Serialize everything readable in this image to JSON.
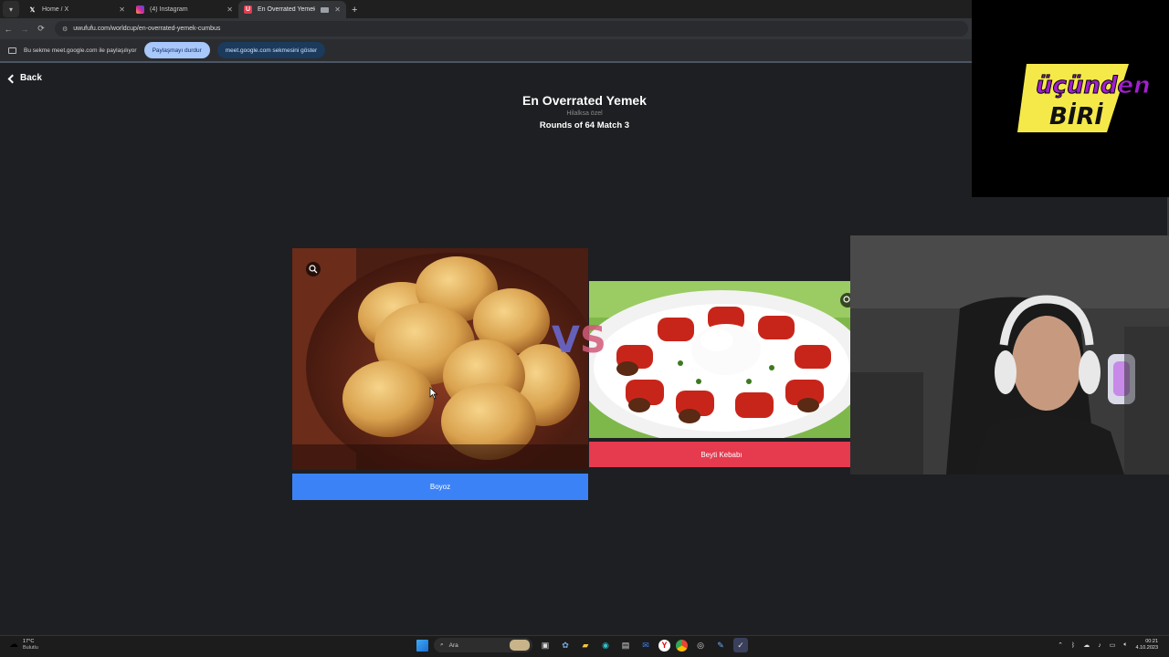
{
  "browser": {
    "tabs": [
      {
        "title": "Home / X",
        "icon": "x-logo-icon",
        "active": false
      },
      {
        "title": "(4) Instagram",
        "icon": "instagram-icon",
        "active": false
      },
      {
        "title": "En Overrated Yemek | Uwu",
        "icon": "uwufufu-icon",
        "active": true
      }
    ],
    "url": "uwufufu.com/worldcup/en-overrated-yemek-cumbus",
    "share_bar": {
      "message": "Bu sekme meet.google.com ile paylaşılıyor",
      "stop_button": "Paylaşmayı durdur",
      "show_button": "meet.google.com sekmesini göster"
    }
  },
  "page": {
    "back_label": "Back",
    "title": "En Overrated Yemek",
    "subtitle": "Hilalksa özel",
    "round_text": "Rounds of 64 Match 3",
    "vs_text": {
      "v": "V",
      "s": "S"
    },
    "left_choice": {
      "label": "Boyoz",
      "color": "#3b82f6"
    },
    "right_choice": {
      "label": "Beyti Kebabı",
      "color": "#e63a4f"
    }
  },
  "overlay": {
    "logo_line1": "üçünden",
    "logo_line2": "BİRİ",
    "logo_colors": {
      "yellow": "#f5e94a",
      "purple": "#a21fd0"
    }
  },
  "taskbar": {
    "weather_temp": "17°C",
    "weather_desc": "Bulutlu",
    "search_placeholder": "Ara",
    "time": "00:21",
    "date": "4.10.2023"
  }
}
